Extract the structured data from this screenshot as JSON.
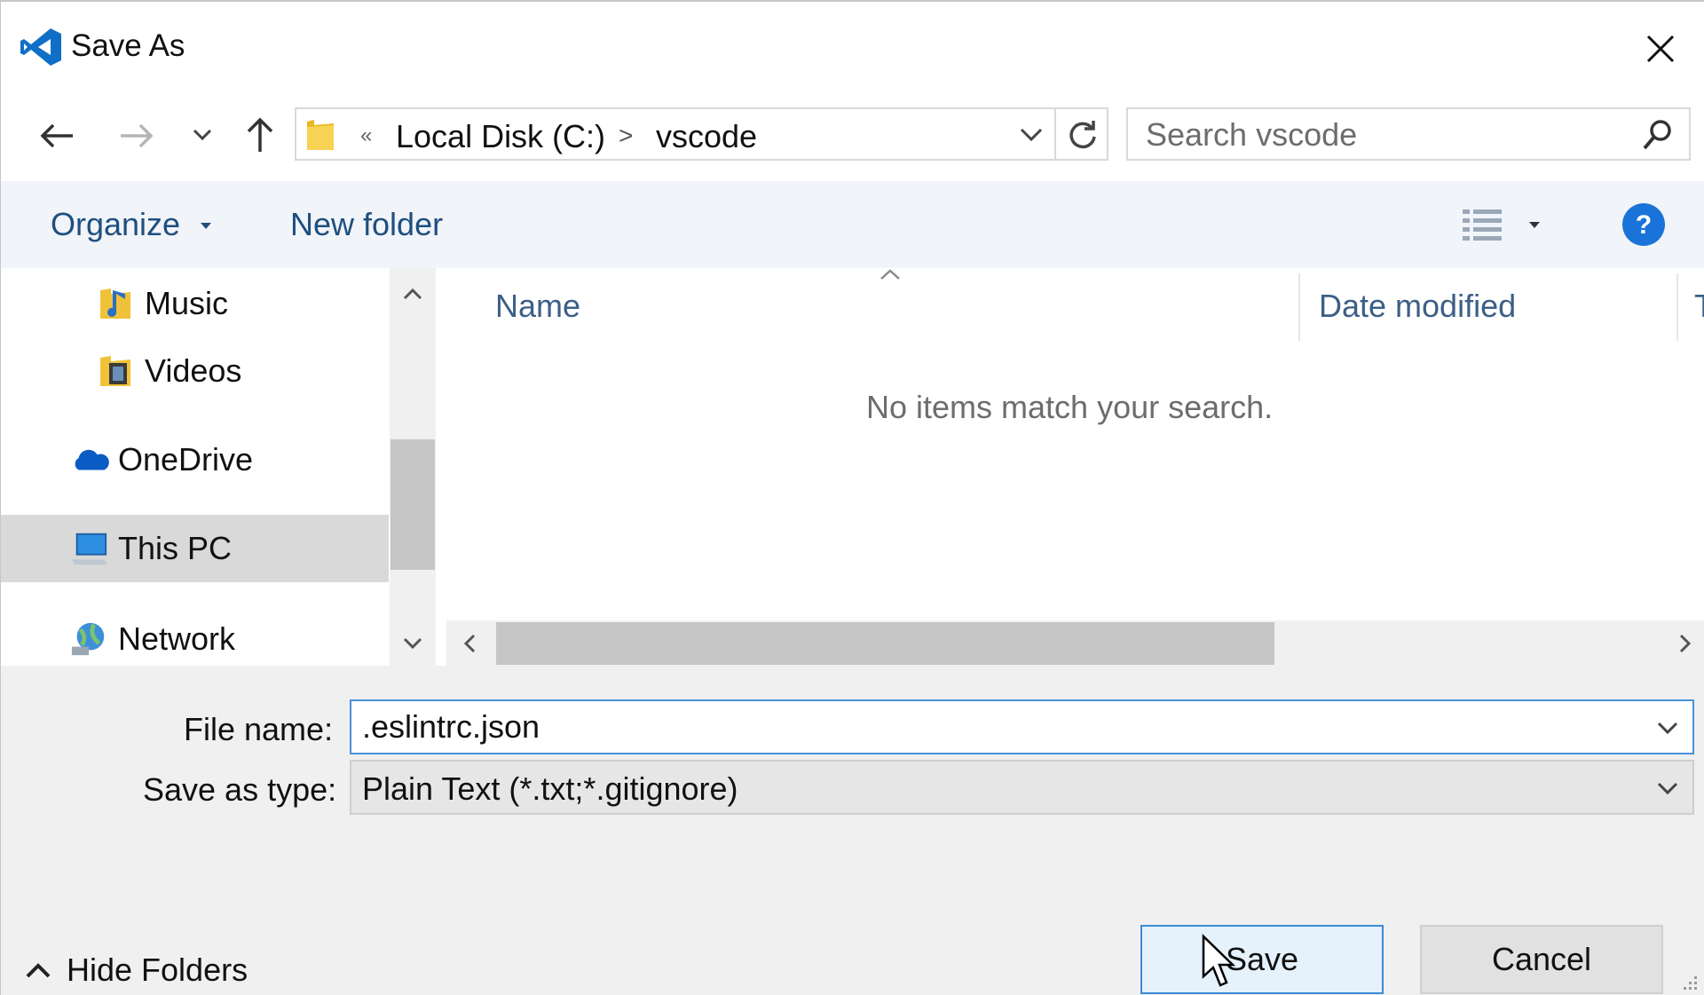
{
  "window": {
    "title": "Save As",
    "colors": {
      "accent": "#0f6fc6",
      "command_bar_bg": "#f1f4f8",
      "link_text": "#1e4f7f"
    }
  },
  "address_bar": {
    "overflow_marker": "«",
    "breadcrumbs": [
      "Local Disk (C:)",
      "vscode"
    ],
    "separator": ">",
    "search_placeholder": "Search vscode"
  },
  "command_bar": {
    "organize_label": "Organize",
    "new_folder_label": "New folder"
  },
  "nav_pane": {
    "items": [
      {
        "label": "Music",
        "icon": "music-folder-icon"
      },
      {
        "label": "Videos",
        "icon": "videos-folder-icon"
      },
      {
        "label": "OneDrive",
        "icon": "onedrive-icon"
      },
      {
        "label": "This PC",
        "icon": "this-pc-icon",
        "selected": true
      },
      {
        "label": "Network",
        "icon": "network-icon"
      }
    ]
  },
  "file_list": {
    "columns": [
      "Name",
      "Date modified",
      "T"
    ],
    "empty_message": "No items match your search."
  },
  "form": {
    "file_name_label": "File name:",
    "file_name_value": ".eslintrc.json",
    "save_type_label": "Save as type:",
    "save_type_value": "Plain Text (*.txt;*.gitignore)"
  },
  "footer": {
    "hide_folders_label": "Hide Folders",
    "save_label": "Save",
    "cancel_label": "Cancel"
  }
}
